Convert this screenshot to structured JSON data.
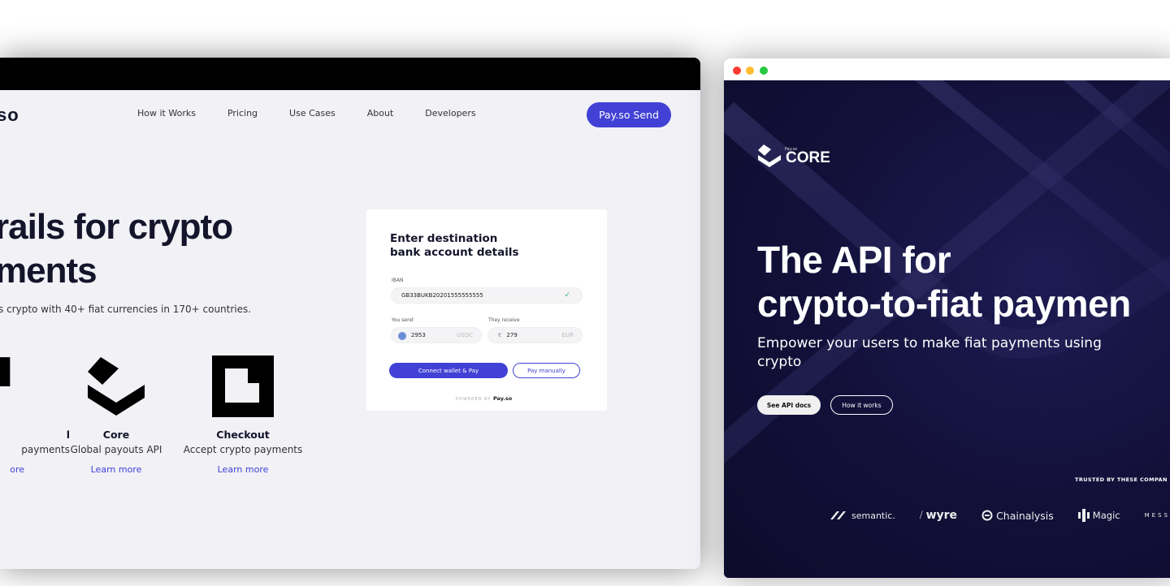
{
  "left_window": {
    "logo_fragment": "so",
    "nav": [
      "How it Works",
      "Pricing",
      "Use Cases",
      "About",
      "Developers"
    ],
    "cta": "Pay.so Send",
    "hero_title_line1": "rails for crypto",
    "hero_title_line2": "ments",
    "hero_subtitle": "s crypto with 40+ fiat currencies in 170+ countries.",
    "products": [
      {
        "name": "l",
        "description": "payments",
        "link": "ore"
      },
      {
        "name": "Core",
        "description": "Global payouts API",
        "link": "Learn more"
      },
      {
        "name": "Checkout",
        "description": "Accept crypto payments",
        "link": "Learn more"
      }
    ],
    "card": {
      "heading_line1": "Enter destination",
      "heading_line2": "bank account details",
      "iban_label": "IBAN",
      "iban_value": "GB33BUKB20201555555555",
      "you_send_label": "You send",
      "you_send_value": "2953",
      "you_send_currency": "USDC",
      "they_receive_label": "They receive",
      "they_receive_symbol": "€",
      "they_receive_value": "279",
      "they_receive_currency": "EUR",
      "connect_button": "Connect wallet & Pay",
      "manual_button": "Pay manually",
      "powered_by": "POWERED BY",
      "powered_brand": "Pay.so"
    }
  },
  "right_window": {
    "logo_small": "Pay.so",
    "logo_big": "CORE",
    "title_line1": "The API for",
    "title_line2": "crypto-to-fiat paymen",
    "subtitle": "Empower your users to make fiat payments using crypto",
    "primary_button": "See API docs",
    "secondary_button": "How it works",
    "trusted": "TRUSTED BY THESE COMPAN",
    "logos": [
      "semantic.",
      "wyre",
      "Chainalysis",
      "Magic",
      "MESS"
    ]
  },
  "colors": {
    "accent": "#4141d6",
    "left_bg": "#f1f1f6",
    "right_bg": "#14123a",
    "dot_red": "#ff3b30",
    "dot_yellow": "#ffbd2e",
    "dot_green": "#28c840"
  }
}
